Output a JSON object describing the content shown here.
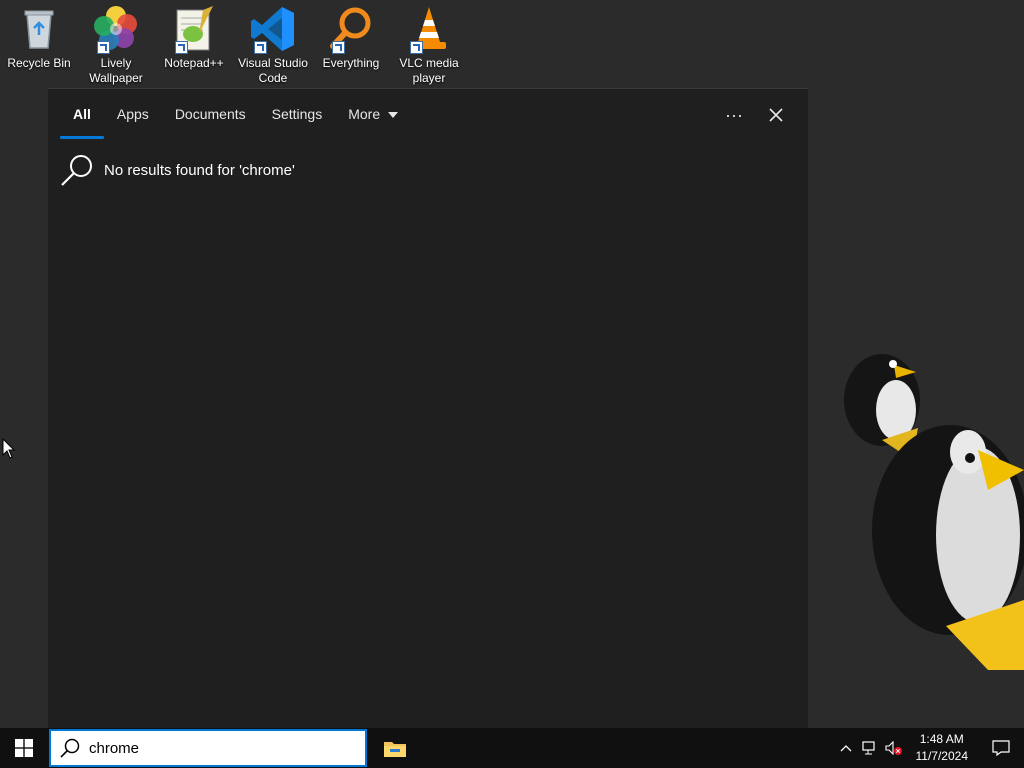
{
  "desktop": {
    "icons": [
      {
        "label": "Recycle Bin",
        "icon": "recycle-bin-icon"
      },
      {
        "label": "Lively Wallpaper",
        "icon": "lively-wallpaper-icon"
      },
      {
        "label": "Notepad++",
        "icon": "notepad-plus-plus-icon"
      },
      {
        "label": "Visual Studio Code",
        "icon": "vscode-icon"
      },
      {
        "label": "Everything",
        "icon": "everything-search-icon"
      },
      {
        "label": "VLC media player",
        "icon": "vlc-icon"
      }
    ]
  },
  "search_panel": {
    "tabs": [
      {
        "label": "All",
        "active": true
      },
      {
        "label": "Apps"
      },
      {
        "label": "Documents"
      },
      {
        "label": "Settings"
      },
      {
        "label": "More"
      }
    ],
    "more_options": "···",
    "close": "✕",
    "no_results_text": "No results found for 'chrome'"
  },
  "taskbar": {
    "search_value": "chrome",
    "clock_time": "1:48 AM",
    "clock_date": "11/7/2024"
  },
  "colors": {
    "accent": "#0078d7",
    "panel_bg": "#1f1f1f",
    "taskbar_bg": "#101010",
    "desktop_bg": "#2b2b2b"
  }
}
